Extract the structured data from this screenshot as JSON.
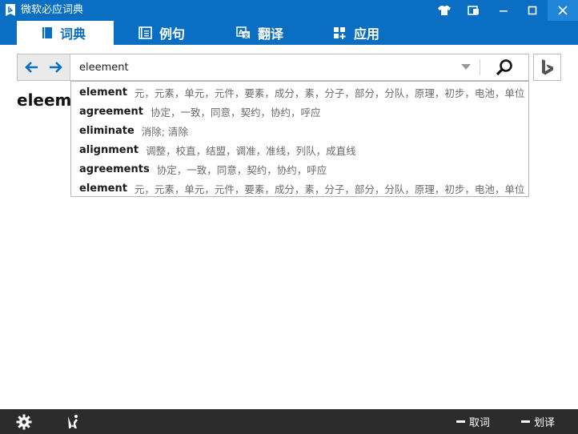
{
  "window": {
    "title": "微软必应词典",
    "accent": "#0a6fc2"
  },
  "tabs": [
    {
      "label": "词典",
      "icon": "book-icon",
      "active": true
    },
    {
      "label": "例句",
      "icon": "document-list-icon",
      "active": false
    },
    {
      "label": "翻译",
      "icon": "translate-icon",
      "active": false
    },
    {
      "label": "应用",
      "icon": "apps-icon",
      "active": false
    }
  ],
  "search": {
    "query": "eleement"
  },
  "headword": "eleeme",
  "suggestions": [
    {
      "word": "element",
      "def": "元，元素，单元，元件，要素，成分，素，分子，部分，分队，原理，初步，电池，单位"
    },
    {
      "word": "agreement",
      "def": "协定，一致，同意，契约，协约，呼应"
    },
    {
      "word": "eliminate",
      "def": "消除; 清除"
    },
    {
      "word": "alignment",
      "def": "调整，校直，结盟，调准，准线，列队，成直线"
    },
    {
      "word": "agreements",
      "def": "协定，一致，同意，契约，协约，呼应"
    },
    {
      "word": "element",
      "def": "元，元素，单元，元件，要素，成分，素，分子，部分，分队，原理，初步，电池，单位"
    }
  ],
  "bottombar": {
    "toggle1": "取词",
    "toggle2": "划译"
  }
}
